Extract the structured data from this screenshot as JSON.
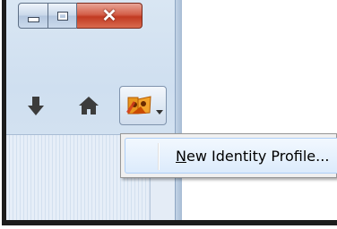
{
  "window": {
    "caption": {
      "minimize_icon": "minimize-icon",
      "maximize_icon": "maximize-icon",
      "close_glyph": "✕"
    }
  },
  "toolbar": {
    "icons": [
      "download-arrow-icon",
      "home-icon",
      "identity-profile-icon",
      "dropdown-arrow-icon"
    ]
  },
  "menu": {
    "item": {
      "mnemonic": "N",
      "label_rest": "ew Identity Profile..."
    }
  },
  "colors": {
    "close_button": "#c23a22",
    "menu_highlight": "#dcebfc",
    "window_chrome": "#cfdff0"
  }
}
